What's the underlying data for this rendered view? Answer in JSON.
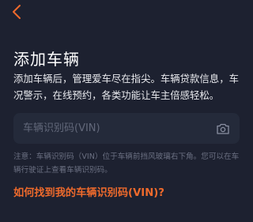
{
  "nav": {
    "back_icon": "chevron-left-icon"
  },
  "page": {
    "title": "添加车辆",
    "description": "添加车辆后，管理爱车尽在指尖。车辆贷款信息，车况警示，在线预约，各类功能让车主倍感轻松。"
  },
  "vin_field": {
    "placeholder": "车辆识别码(VIN)",
    "value": "",
    "camera_icon": "camera-icon"
  },
  "note": "注意：车辆识别码（VIN）位于车辆前挡风玻璃右下角。您可以在车辆行驶证上查看车辆识别码。",
  "help_link": "如何找到我的车辆识别码(VIN)?",
  "colors": {
    "background": "#1d2130",
    "accent": "#ee6a2c",
    "field_background": "#242a3a"
  }
}
